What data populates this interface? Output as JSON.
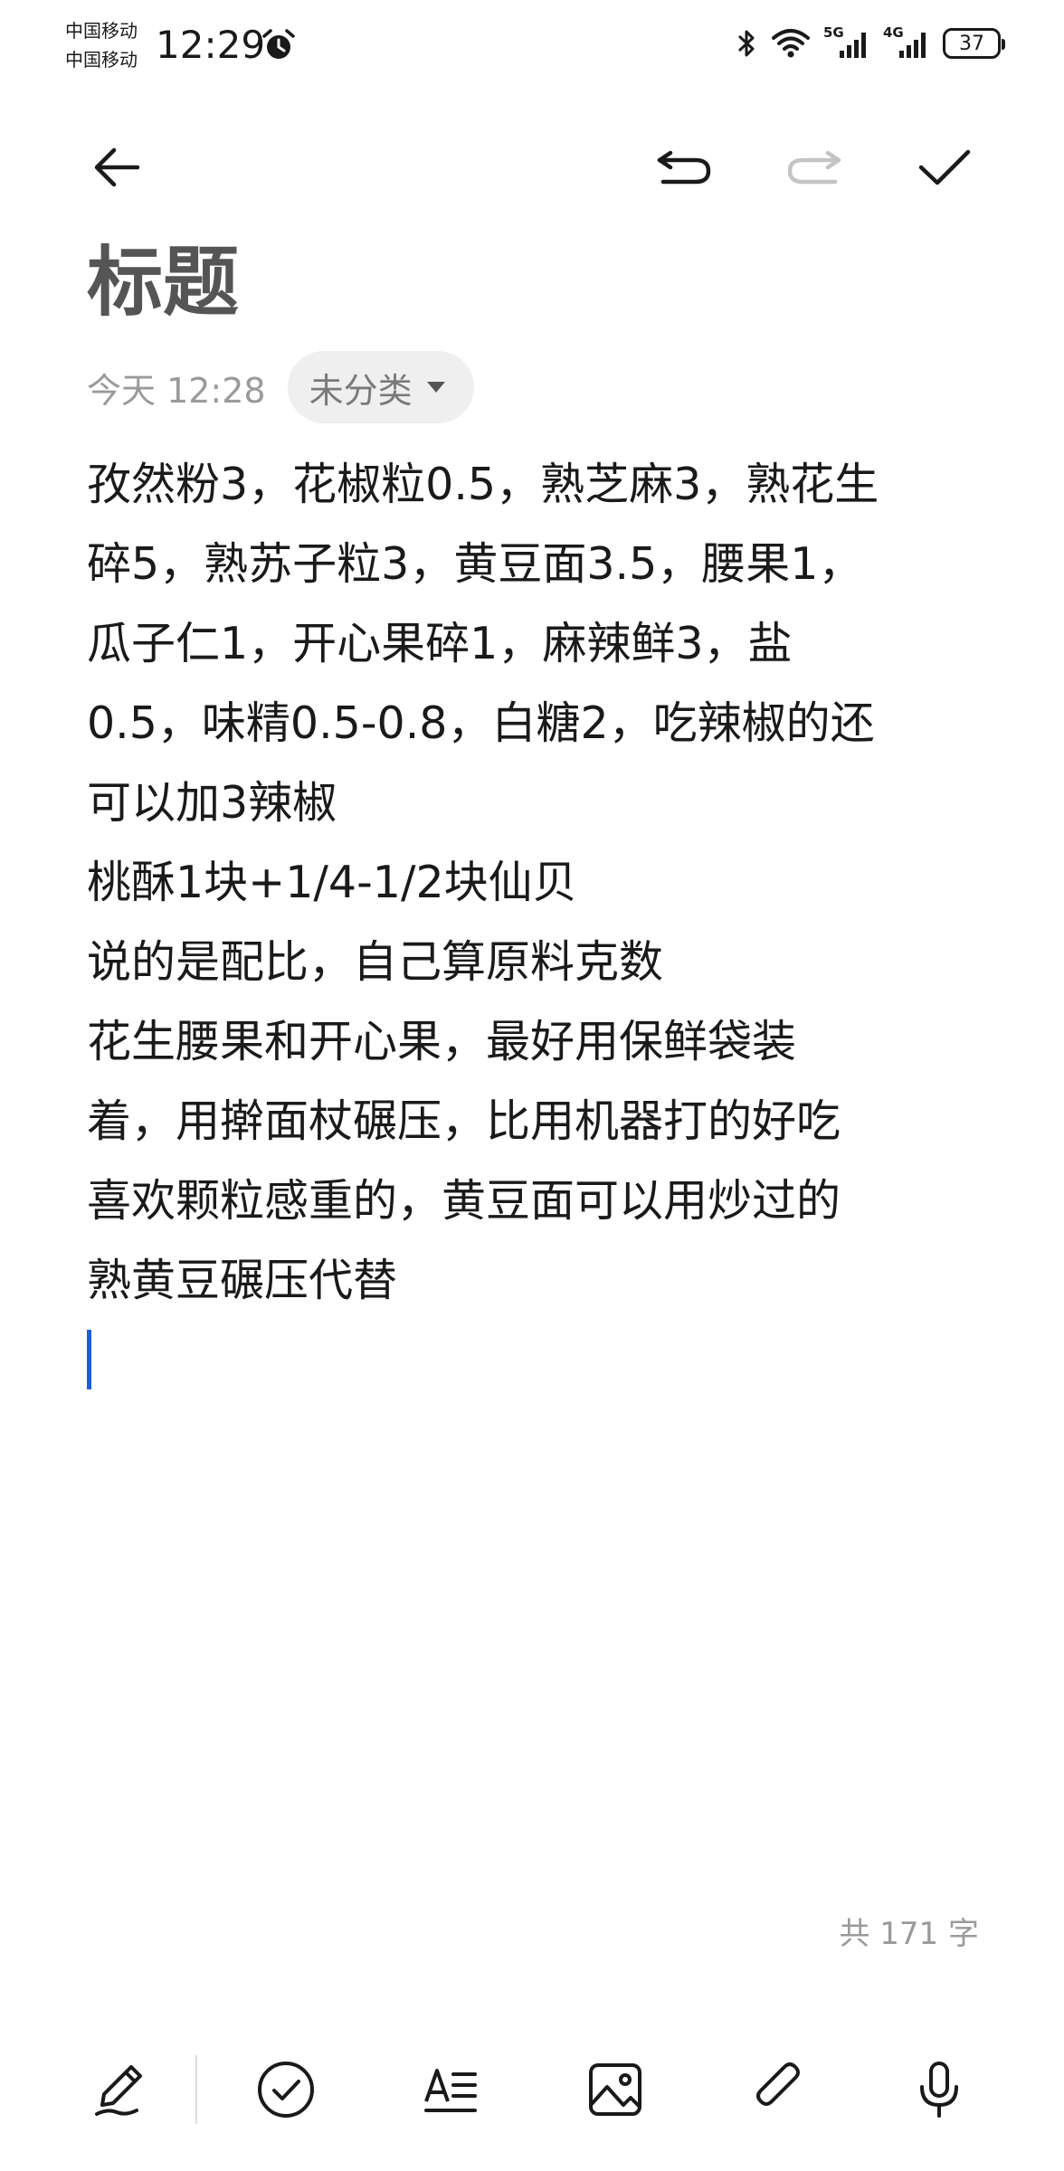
{
  "status_bar": {
    "carrier_1": "中国移动",
    "carrier_2": "中国移动",
    "time": "12:29",
    "network_tag_1": "5G",
    "network_tag_2": "4G",
    "battery": "37",
    "icons": [
      "alarm-icon",
      "bluetooth-icon",
      "wifi-icon",
      "signal-5g-icon",
      "signal-4g-icon",
      "battery-icon"
    ]
  },
  "toolbar": {
    "icons": [
      "back-arrow-icon",
      "undo-icon",
      "redo-icon",
      "done-checkmark-icon"
    ],
    "redo_enabled": false
  },
  "note": {
    "title": "标题",
    "date": "今天 12:28",
    "category": "未分类",
    "lines": [
      "孜然粉3，花椒粒0.5，熟芝麻3，熟花生",
      "碎5，熟苏子粒3，黄豆面3.5，腰果1，",
      "瓜子仁1，开心果碎1，麻辣鲜3，盐",
      "0.5，味精0.5-0.8，白糖2，吃辣椒的还",
      "可以加3辣椒",
      "桃酥1块+1/4-1/2块仙贝",
      "说的是配比，自己算原料克数",
      "花生腰果和开心果，最好用保鲜袋装",
      "着，用擀面杖碾压，比用机器打的好吃",
      "喜欢颗粒感重的，黄豆面可以用炒过的",
      "熟黄豆碾压代替"
    ],
    "word_count": "共 171 字"
  },
  "bottom_toolbar": {
    "icons": [
      "pen-handwriting-icon",
      "checklist-icon",
      "text-format-icon",
      "image-icon",
      "attachment-icon",
      "microphone-icon"
    ]
  },
  "colors": {
    "caret": "#1e5fd8",
    "title": "#555555",
    "muted": "#9a9a9a",
    "chip_bg": "#efefef"
  }
}
